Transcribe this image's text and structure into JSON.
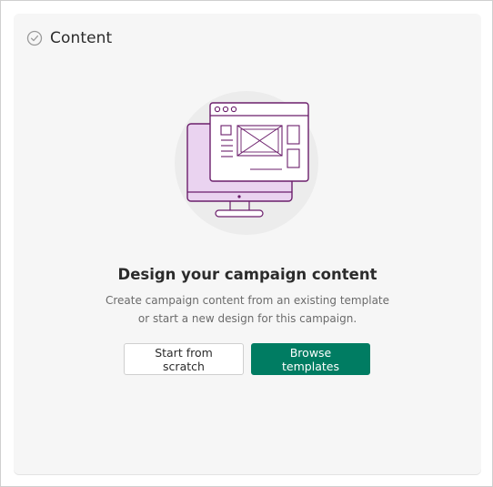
{
  "section": {
    "title": "Content",
    "status_icon": "check-circle-icon"
  },
  "empty_state": {
    "illustration": "monitor-template-illustration",
    "headline": "Design your campaign content",
    "description": "Create campaign content from an existing template or start a new design for this campaign."
  },
  "actions": {
    "secondary_label": "Start from scratch",
    "primary_label": "Browse templates"
  },
  "colors": {
    "primary": "#007c62",
    "illustration_accent": "#6b1e6b",
    "illustration_fill": "#ead3f0"
  }
}
